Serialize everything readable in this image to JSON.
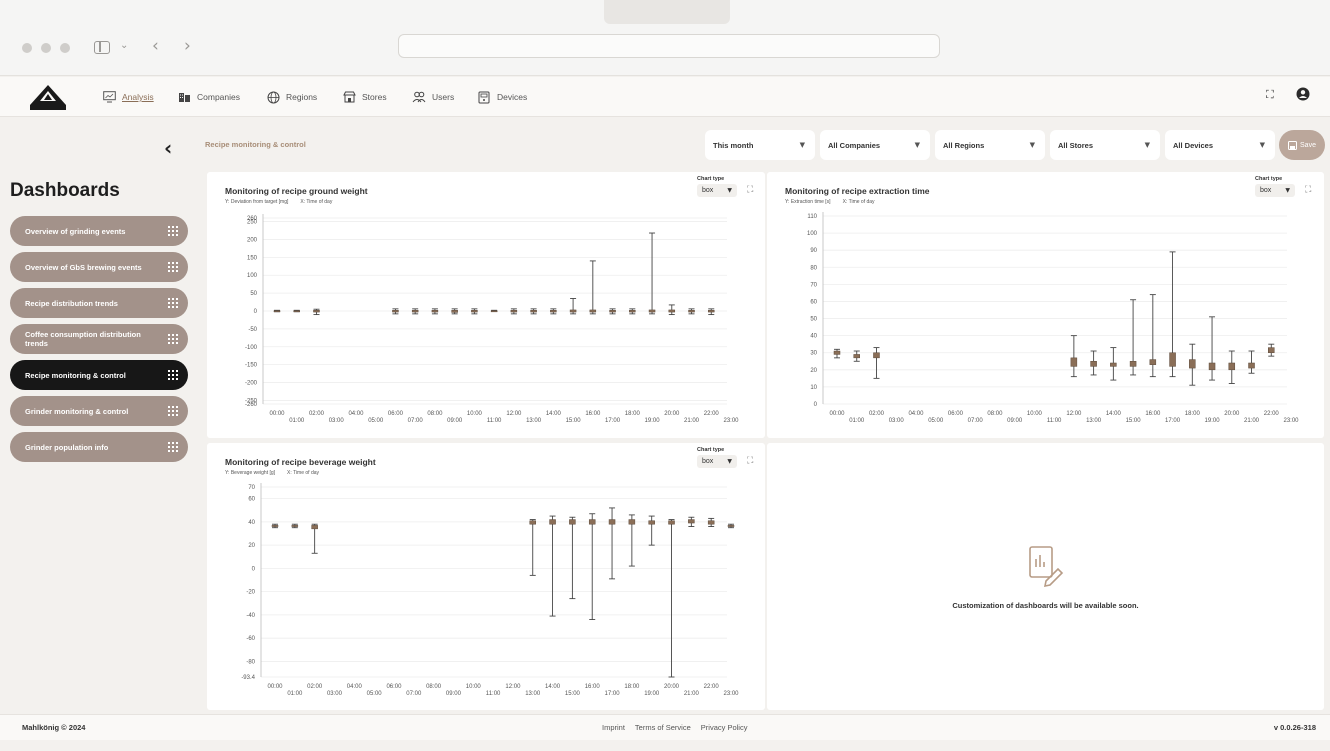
{
  "nav": {
    "items": [
      {
        "label": "Analysis",
        "icon": "monitor-chart-icon",
        "active": true
      },
      {
        "label": "Companies",
        "icon": "building-icon"
      },
      {
        "label": "Regions",
        "icon": "globe-icon"
      },
      {
        "label": "Stores",
        "icon": "store-icon"
      },
      {
        "label": "Users",
        "icon": "users-icon"
      },
      {
        "label": "Devices",
        "icon": "device-icon"
      }
    ]
  },
  "sidebar": {
    "title": "Dashboards",
    "items": [
      {
        "label": "Overview of grinding events"
      },
      {
        "label": "Overview of GbS brewing events"
      },
      {
        "label": "Recipe distribution trends"
      },
      {
        "label": "Coffee consumption distribution trends"
      },
      {
        "label": "Recipe monitoring & control",
        "active": true
      },
      {
        "label": "Grinder monitoring & control"
      },
      {
        "label": "Grinder population info"
      }
    ]
  },
  "breadcrumb": "Recipe monitoring & control",
  "filters": {
    "period": "This month",
    "companies": "All Companies",
    "regions": "All Regions",
    "stores": "All Stores",
    "devices": "All Devices",
    "save_label": "Save"
  },
  "chart_type_label": "Chart type",
  "chart_type_value": "box",
  "x_ticks_top": [
    "00:00",
    "02:00",
    "04:00",
    "06:00",
    "08:00",
    "10:00",
    "12:00",
    "14:00",
    "16:00",
    "18:00",
    "20:00",
    "22:00"
  ],
  "x_ticks_bottom": [
    "01:00",
    "03:00",
    "05:00",
    "07:00",
    "09:00",
    "11:00",
    "13:00",
    "15:00",
    "17:00",
    "19:00",
    "21:00",
    "23:00"
  ],
  "chart_data": [
    {
      "type": "box",
      "title": "Monitoring of recipe ground weight",
      "ylabel": "Y: Deviation from target [mg]",
      "xlabel": "X: Time of day",
      "ylim": [
        -260,
        260
      ],
      "yticks": [
        -260,
        -250,
        -200,
        -150,
        -100,
        -50,
        0,
        50,
        100,
        150,
        200,
        250,
        260
      ],
      "boxes": [
        {
          "x": 0,
          "low": -2,
          "q1": -1,
          "q3": 1,
          "high": 2
        },
        {
          "x": 1,
          "low": -2,
          "q1": -1,
          "q3": 1,
          "high": 2
        },
        {
          "x": 2,
          "low": -10,
          "q1": -3,
          "q3": 2,
          "high": 5
        },
        {
          "x": 6,
          "low": -8,
          "q1": -3,
          "q3": 2,
          "high": 6
        },
        {
          "x": 7,
          "low": -8,
          "q1": -3,
          "q3": 2,
          "high": 6
        },
        {
          "x": 8,
          "low": -8,
          "q1": -3,
          "q3": 2,
          "high": 6
        },
        {
          "x": 9,
          "low": -8,
          "q1": -4,
          "q3": 2,
          "high": 6
        },
        {
          "x": 10,
          "low": -8,
          "q1": -3,
          "q3": 2,
          "high": 6
        },
        {
          "x": 11,
          "low": -1,
          "q1": 0,
          "q3": 1,
          "high": 2
        },
        {
          "x": 12,
          "low": -8,
          "q1": -3,
          "q3": 2,
          "high": 6
        },
        {
          "x": 13,
          "low": -8,
          "q1": -3,
          "q3": 2,
          "high": 6
        },
        {
          "x": 14,
          "low": -8,
          "q1": -3,
          "q3": 2,
          "high": 6
        },
        {
          "x": 15,
          "low": -8,
          "q1": -3,
          "q3": 3,
          "high": 35
        },
        {
          "x": 16,
          "low": -8,
          "q1": -3,
          "q3": 3,
          "high": 140
        },
        {
          "x": 17,
          "low": -8,
          "q1": -3,
          "q3": 2,
          "high": 6
        },
        {
          "x": 18,
          "low": -8,
          "q1": -3,
          "q3": 2,
          "high": 6
        },
        {
          "x": 19,
          "low": -8,
          "q1": -3,
          "q3": 3,
          "high": 218
        },
        {
          "x": 20,
          "low": -10,
          "q1": -3,
          "q3": 3,
          "high": 17
        },
        {
          "x": 21,
          "low": -8,
          "q1": -3,
          "q3": 2,
          "high": 6
        },
        {
          "x": 22,
          "low": -10,
          "q1": -3,
          "q3": 2,
          "high": 6
        }
      ]
    },
    {
      "type": "box",
      "title": "Monitoring of recipe extraction time",
      "ylabel": "Y: Extraction time [s]",
      "xlabel": "X: Time of day",
      "ylim": [
        0,
        110
      ],
      "yticks": [
        0,
        10,
        20,
        30,
        40,
        50,
        60,
        70,
        80,
        90,
        100,
        110
      ],
      "boxes": [
        {
          "x": 0,
          "low": 27,
          "q1": 29,
          "q3": 31,
          "high": 32
        },
        {
          "x": 1,
          "low": 25,
          "q1": 27,
          "q3": 29,
          "high": 31
        },
        {
          "x": 2,
          "low": 15,
          "q1": 27,
          "q3": 30,
          "high": 33
        },
        {
          "x": 12,
          "low": 16,
          "q1": 22,
          "q3": 27,
          "high": 40
        },
        {
          "x": 13,
          "low": 17,
          "q1": 22,
          "q3": 25,
          "high": 31
        },
        {
          "x": 14,
          "low": 14,
          "q1": 22,
          "q3": 24,
          "high": 33
        },
        {
          "x": 15,
          "low": 17,
          "q1": 22,
          "q3": 25,
          "high": 61
        },
        {
          "x": 16,
          "low": 16,
          "q1": 23,
          "q3": 26,
          "high": 64
        },
        {
          "x": 17,
          "low": 16,
          "q1": 22,
          "q3": 30,
          "high": 89
        },
        {
          "x": 18,
          "low": 11,
          "q1": 21,
          "q3": 26,
          "high": 35
        },
        {
          "x": 19,
          "low": 14,
          "q1": 20,
          "q3": 24,
          "high": 51
        },
        {
          "x": 20,
          "low": 12,
          "q1": 20,
          "q3": 24,
          "high": 31
        },
        {
          "x": 21,
          "low": 18,
          "q1": 21,
          "q3": 24,
          "high": 31
        },
        {
          "x": 22,
          "low": 28,
          "q1": 30,
          "q3": 33,
          "high": 35
        }
      ]
    },
    {
      "type": "box",
      "title": "Monitoring of recipe beverage weight",
      "ylabel": "Y: Beverage weight [g]",
      "xlabel": "X: Time of day",
      "ylim": [
        -93.4,
        70
      ],
      "yticks": [
        -93.4,
        -80,
        -60,
        -40,
        -20,
        0,
        20,
        40,
        60,
        70
      ],
      "boxes": [
        {
          "x": 0,
          "low": 35,
          "q1": 36,
          "q3": 37,
          "high": 38
        },
        {
          "x": 1,
          "low": 35,
          "q1": 36,
          "q3": 37,
          "high": 38
        },
        {
          "x": 2,
          "low": 13,
          "q1": 34,
          "q3": 37,
          "high": 38
        },
        {
          "x": 13,
          "low": -6,
          "q1": 38,
          "q3": 41,
          "high": 42
        },
        {
          "x": 14,
          "low": -41,
          "q1": 38,
          "q3": 42,
          "high": 45
        },
        {
          "x": 15,
          "low": -26,
          "q1": 38,
          "q3": 42,
          "high": 44
        },
        {
          "x": 16,
          "low": -44,
          "q1": 38,
          "q3": 42,
          "high": 47
        },
        {
          "x": 17,
          "low": -9,
          "q1": 38,
          "q3": 42,
          "high": 52
        },
        {
          "x": 18,
          "low": 2,
          "q1": 38,
          "q3": 42,
          "high": 46
        },
        {
          "x": 19,
          "low": 20,
          "q1": 38,
          "q3": 41,
          "high": 45
        },
        {
          "x": 20,
          "low": -93.4,
          "q1": 38,
          "q3": 41,
          "high": 42
        },
        {
          "x": 21,
          "low": 36,
          "q1": 39,
          "q3": 42,
          "high": 44
        },
        {
          "x": 22,
          "low": 36,
          "q1": 38,
          "q3": 41,
          "high": 43
        },
        {
          "x": 23,
          "low": 35,
          "q1": 36,
          "q3": 37,
          "high": 38
        }
      ]
    }
  ],
  "empty_panel": {
    "message": "Customization of dashboards will be available soon."
  },
  "footer": {
    "copyright": "Mahlkönig © 2024",
    "links": [
      "Imprint",
      "Terms of Service",
      "Privacy Policy"
    ],
    "version": "v 0.0.26-318"
  },
  "colors": {
    "accent": "#a3928a",
    "active": "#171717",
    "box": "#8a6e57"
  }
}
